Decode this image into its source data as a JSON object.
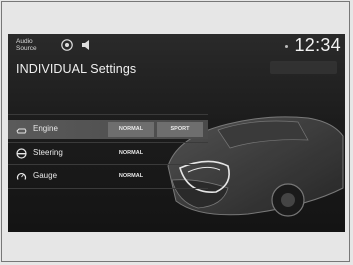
{
  "status_bar": {
    "audio_source_label": "Audio\nSource",
    "clock": "12:34"
  },
  "page": {
    "title": "INDIVIDUAL Settings"
  },
  "settings": [
    {
      "label": "Engine",
      "icon": "engine-icon",
      "options": [
        "NORMAL",
        "SPORT"
      ],
      "selected": "NORMAL"
    },
    {
      "label": "Steering",
      "icon": "steering-wheel-icon",
      "options": [
        "NORMAL"
      ],
      "selected": "NORMAL"
    },
    {
      "label": "Gauge",
      "icon": "gauge-icon",
      "options": [
        "NORMAL"
      ],
      "selected": "NORMAL"
    }
  ],
  "colors": {
    "screen_bg": "#1c1c1c",
    "selected_row": "#555555",
    "active_option": "#6e6e6e",
    "text": "#e8e8e8"
  }
}
